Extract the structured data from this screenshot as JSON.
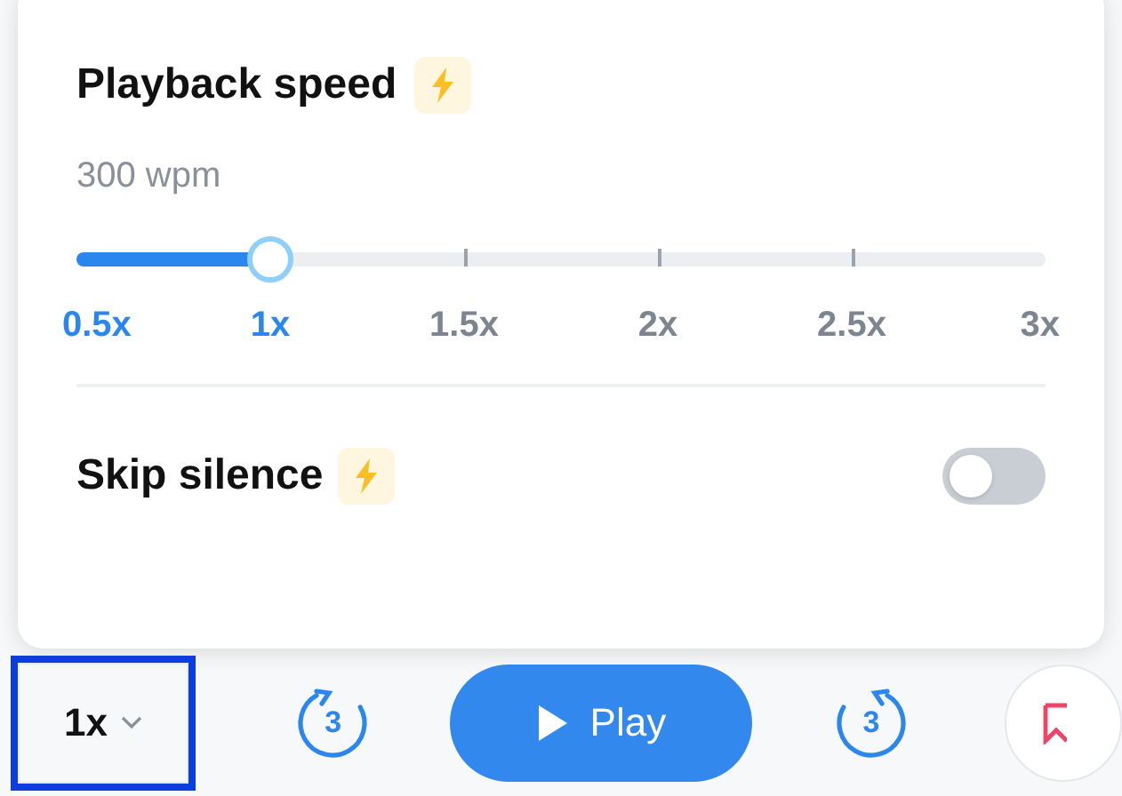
{
  "playback_speed": {
    "title": "Playback speed",
    "premium": true,
    "reading": "300 wpm",
    "level": 0.2,
    "stops": [
      "0.5x",
      "1x",
      "1.5x",
      "2x",
      "2.5x",
      "3x"
    ]
  },
  "skip_silence": {
    "label": "Skip silence",
    "premium": true,
    "on": false
  },
  "player_bar": {
    "speed_button": {
      "label": "1x",
      "focused": true
    },
    "rewind": {
      "label": "3"
    },
    "play": {
      "label": "Play"
    },
    "forward": {
      "label": "3"
    }
  }
}
